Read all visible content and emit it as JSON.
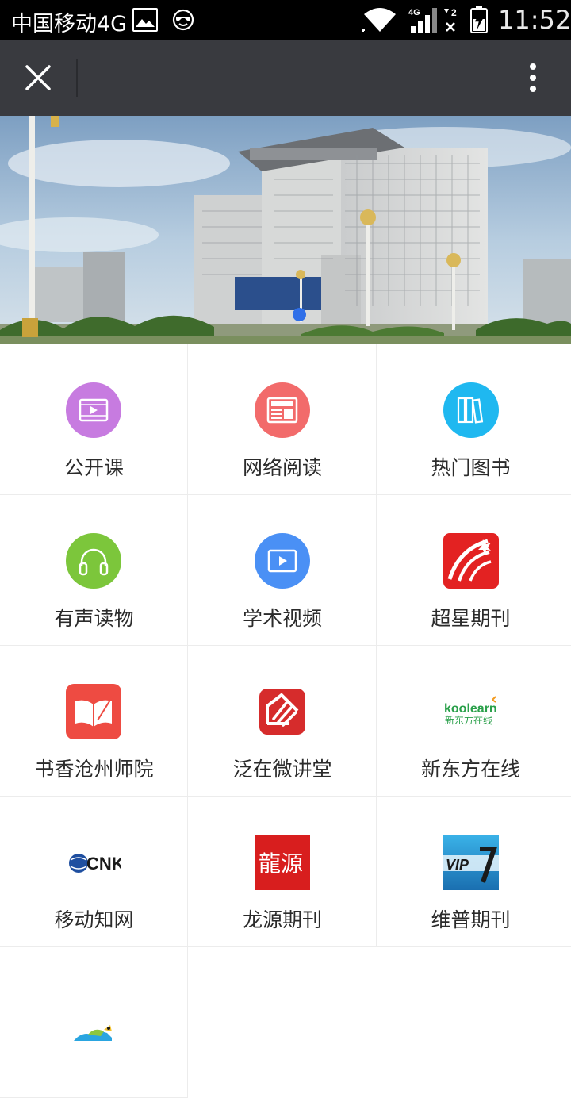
{
  "status_bar": {
    "carrier": "中国移动4G",
    "network_type": "4G",
    "sim2": "2",
    "time": "11:52"
  },
  "header": {
    "close_icon": "close-icon",
    "more_icon": "more-vertical-icon"
  },
  "banner": {
    "slide_count": 1,
    "active_slide": 1
  },
  "grid": {
    "items": [
      {
        "label": "公开课",
        "icon": "film-icon",
        "color": "#c77be0"
      },
      {
        "label": "网络阅读",
        "icon": "newspaper-icon",
        "color": "#f26b6b"
      },
      {
        "label": "热门图书",
        "icon": "books-icon",
        "color": "#1fb8f0"
      },
      {
        "label": "有声读物",
        "icon": "headphones-icon",
        "color": "#7cc63b"
      },
      {
        "label": "学术视频",
        "icon": "video-play-icon",
        "color": "#4a90f5"
      },
      {
        "label": "超星期刊",
        "icon": "chaoxing-logo-icon",
        "color": "#e32222"
      },
      {
        "label": "书香沧州师院",
        "icon": "open-book-logo-icon",
        "color": "#ee4b42"
      },
      {
        "label": "泛在微讲堂",
        "icon": "hand-logo-icon",
        "color": "#d62c2c"
      },
      {
        "label": "新东方在线",
        "icon": "koolearn-logo-icon",
        "color": "#2aa04a"
      },
      {
        "label": "移动知网",
        "icon": "cnki-logo-icon",
        "color": "#1a1a1a"
      },
      {
        "label": "龙源期刊",
        "icon": "longyuan-logo-icon",
        "color": "#d81e1e"
      },
      {
        "label": "维普期刊",
        "icon": "vip-logo-icon",
        "color": "#2a8ed4"
      },
      {
        "label": "",
        "icon": "colorful-logo-icon",
        "color": "#2aa5e0"
      }
    ],
    "logo_texts": {
      "koolearn": "koolearn",
      "koolearn_cn": "新东方在线",
      "cnki": "CNKi",
      "longyuan": "龍源",
      "vip": "VIP"
    }
  }
}
